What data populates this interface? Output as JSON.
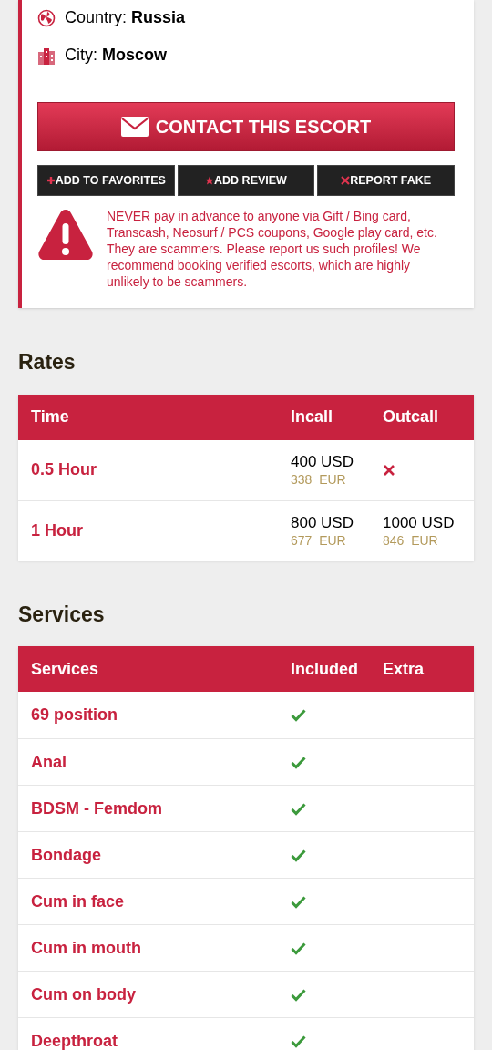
{
  "details": [
    {
      "kind": "country",
      "label": "Country:",
      "value": "Russia"
    },
    {
      "kind": "city",
      "label": "City:",
      "value": "Moscow"
    }
  ],
  "contact_button": "CONTACT THIS ESCORT",
  "actions": [
    {
      "kind": "plus",
      "label": "ADD TO FAVORITES"
    },
    {
      "kind": "star",
      "label": "ADD REVIEW"
    },
    {
      "kind": "cross",
      "label": "REPORT FAKE"
    }
  ],
  "warning": "NEVER pay in advance to anyone via Gift / Bing card, Transcash, Neosurf / PCS coupons, Google play card, etc. They are scammers. Please report us such profiles! We recommend booking verified escorts, which are highly unlikely to be scammers.",
  "rates": {
    "title": "Rates",
    "columns": [
      "Time",
      "Incall",
      "Outcall"
    ],
    "rows": [
      {
        "time": "0.5 Hour",
        "incall": {
          "kind": "price",
          "usd": "400 USD",
          "eur": "338  EUR"
        },
        "outcall": {
          "kind": "unavailable"
        }
      },
      {
        "time": "1 Hour",
        "incall": {
          "kind": "price",
          "usd": "800 USD",
          "eur": "677  EUR"
        },
        "outcall": {
          "kind": "price",
          "usd": "1000 USD",
          "eur": "846  EUR"
        }
      }
    ]
  },
  "services": {
    "title": "Services",
    "columns": [
      "Services",
      "Included",
      "Extra"
    ],
    "rows": [
      {
        "name": "69 position",
        "included": true
      },
      {
        "name": "Anal",
        "included": true
      },
      {
        "name": "BDSM - Femdom",
        "included": true
      },
      {
        "name": "Bondage",
        "included": true
      },
      {
        "name": "Cum in face",
        "included": true
      },
      {
        "name": "Cum in mouth",
        "included": true
      },
      {
        "name": "Cum on body",
        "included": true
      },
      {
        "name": "Deepthroat",
        "included": true
      }
    ]
  }
}
